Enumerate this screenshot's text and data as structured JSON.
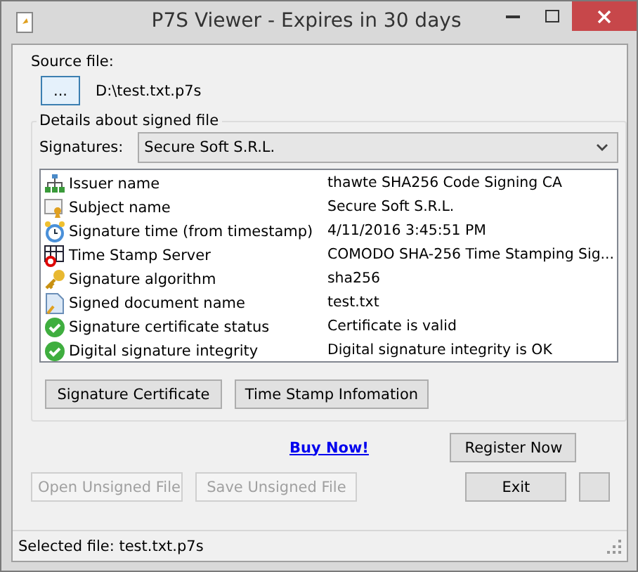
{
  "window": {
    "title": "P7S Viewer - Expires in 30 days"
  },
  "source": {
    "label": "Source file:",
    "browse_button": "...",
    "path": "D:\\test.txt.p7s"
  },
  "details": {
    "title": "Details about signed file",
    "signatures_label": "Signatures:",
    "signature_value": "Secure Soft S.R.L.",
    "rows": [
      {
        "kind": "issuer",
        "name": "Issuer name",
        "value": "thawte SHA256 Code Signing CA"
      },
      {
        "kind": "subject",
        "name": "Subject name",
        "value": "Secure Soft S.R.L."
      },
      {
        "kind": "time",
        "name": "Signature time (from timestamp)",
        "value": "4/11/2016 3:45:51 PM"
      },
      {
        "kind": "server",
        "name": "Time Stamp Server",
        "value": "COMODO SHA-256 Time Stamping Sig..."
      },
      {
        "kind": "key",
        "name": "Signature algorithm",
        "value": "sha256"
      },
      {
        "kind": "document",
        "name": "Signed document name",
        "value": "test.txt"
      },
      {
        "kind": "ok",
        "name": "Signature certificate status",
        "value": "Certificate is valid"
      },
      {
        "kind": "ok",
        "name": "Digital signature integrity",
        "value": "Digital signature integrity is OK"
      }
    ],
    "buttons": [
      "Signature Certificate",
      "Time Stamp Infomation"
    ]
  },
  "buy_link": "Buy Now!",
  "register_button": "Register Now",
  "bottom_buttons": [
    {
      "label": "Open Unsigned File",
      "disabled": true
    },
    {
      "label": "Save Unsigned File",
      "disabled": true
    },
    {
      "label": "Exit",
      "disabled": false
    }
  ],
  "status_bar": "Selected file: test.txt.p7s"
}
